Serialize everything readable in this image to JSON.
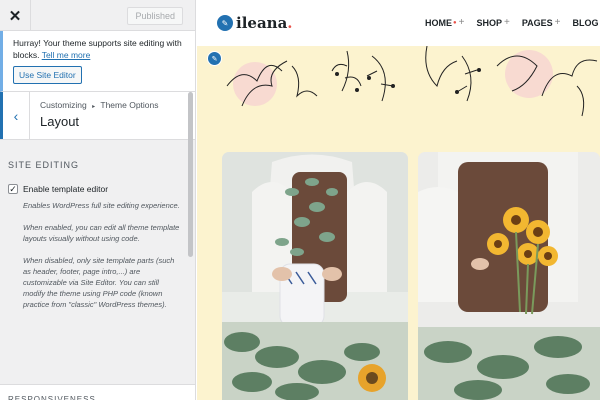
{
  "topbar": {
    "close_label": "✕",
    "publish_label": "Published"
  },
  "notice": {
    "text": "Hurray! Your theme supports site editing with blocks.",
    "link": "Tell me more",
    "button": "Use Site Editor"
  },
  "section": {
    "breadcrumb_root": "Customizing",
    "breadcrumb_sep": "▸",
    "breadcrumb_parent": "Theme Options",
    "title": "Layout"
  },
  "site_editing": {
    "group_title": "SITE EDITING",
    "checkbox_label": "Enable template editor",
    "checked": true,
    "desc1": "Enables WordPress full site editing experience.",
    "desc2": "When enabled, you can edit all theme template layouts visually without using code.",
    "desc3": "When disabled, only site template parts (such as header, footer, page intro,...) are customizable via Site Editor. You can still modify the theme using PHP code (known practice from \"classic\" WordPress themes)."
  },
  "next_group": "RESPONSIVENESS",
  "preview": {
    "logo_text": "ileana",
    "logo_dot": ".",
    "nav": [
      {
        "label": "HOME"
      },
      {
        "label": "SHOP"
      },
      {
        "label": "PAGES"
      },
      {
        "label": "BLOG"
      }
    ]
  },
  "colors": {
    "accent": "#2271b1",
    "preview_bg": "#fcf3cf",
    "brand_dot": "#e8524a"
  },
  "icons": {
    "close": "close-icon",
    "back": "chevron-left-icon",
    "check": "checkmark-icon",
    "edit": "pencil-icon",
    "plus": "plus-icon"
  }
}
